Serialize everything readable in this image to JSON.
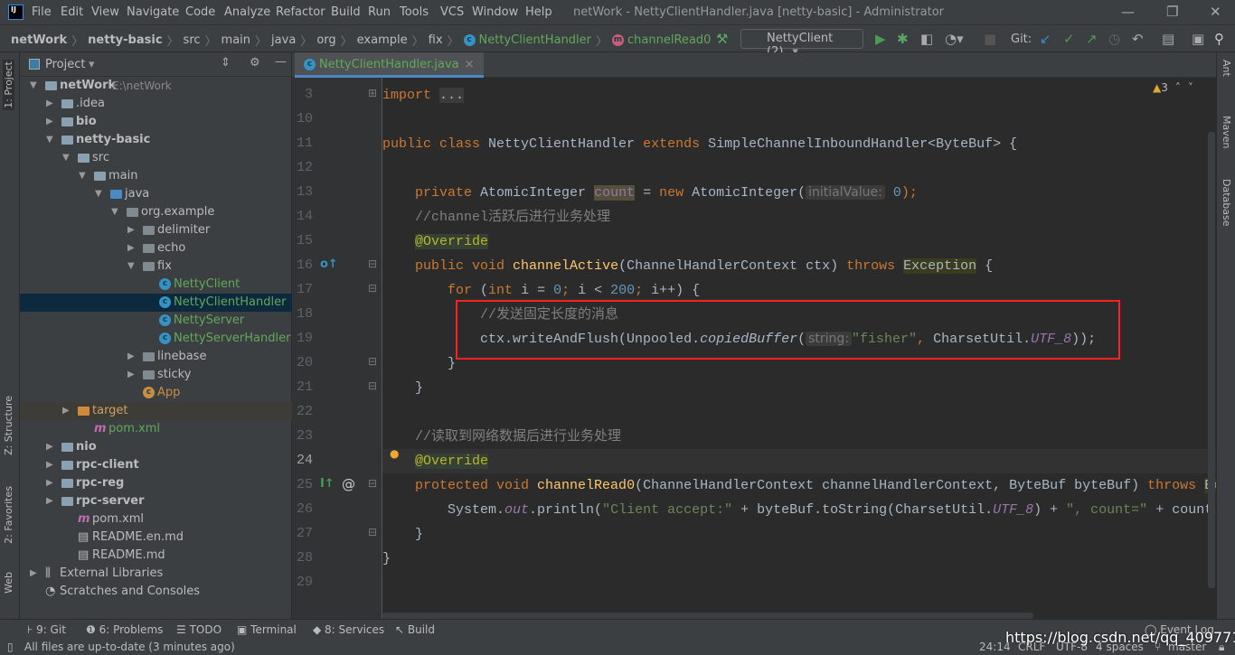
{
  "titlebar": {
    "menu": [
      "File",
      "Edit",
      "View",
      "Navigate",
      "Code",
      "Analyze",
      "Refactor",
      "Build",
      "Run",
      "Tools",
      "VCS",
      "Window",
      "Help"
    ],
    "title": "netWork - NettyClientHandler.java [netty-basic] - Administrator"
  },
  "breadcrumb": [
    {
      "label": "netWork",
      "bold": true
    },
    {
      "label": "netty-basic",
      "bold": true
    },
    {
      "label": "src"
    },
    {
      "label": "main"
    },
    {
      "label": "java"
    },
    {
      "label": "org"
    },
    {
      "label": "example"
    },
    {
      "label": "fix"
    },
    {
      "label": "NettyClientHandler",
      "icon": "class-icon"
    },
    {
      "label": "channelRead0",
      "icon": "method-icon"
    }
  ],
  "toolbar": {
    "run_config": "NettyClient (2)",
    "git_label": "Git:"
  },
  "left_tools": [
    "1: Project",
    "Z: Structure",
    "2: Favorites",
    "Web"
  ],
  "right_tools": [
    "Ant",
    "Maven",
    "Database"
  ],
  "project": {
    "header": "Project",
    "tree": [
      {
        "label": "netWork",
        "extra": "E:\\netWork",
        "level": 0,
        "arrow": "down",
        "icon": "module",
        "bold": true
      },
      {
        "label": ".idea",
        "level": 1,
        "arrow": "right",
        "icon": "folder"
      },
      {
        "label": "bio",
        "level": 1,
        "arrow": "right",
        "icon": "folder",
        "bold": true
      },
      {
        "label": "netty-basic",
        "level": 1,
        "arrow": "down",
        "icon": "folder",
        "bold": true
      },
      {
        "label": "src",
        "level": 2,
        "arrow": "down",
        "icon": "folder"
      },
      {
        "label": "main",
        "level": 3,
        "arrow": "down",
        "icon": "folder"
      },
      {
        "label": "java",
        "level": 4,
        "arrow": "down",
        "icon": "folder-blue"
      },
      {
        "label": "org.example",
        "level": 5,
        "arrow": "down",
        "icon": "package"
      },
      {
        "label": "delimiter",
        "level": 6,
        "arrow": "right",
        "icon": "package"
      },
      {
        "label": "echo",
        "level": 6,
        "arrow": "right",
        "icon": "package"
      },
      {
        "label": "fix",
        "level": 6,
        "arrow": "down",
        "icon": "package"
      },
      {
        "label": "NettyClient",
        "level": 7,
        "icon": "class",
        "green": true
      },
      {
        "label": "NettyClientHandler",
        "level": 7,
        "icon": "class",
        "green": true,
        "selected": true
      },
      {
        "label": "NettyServer",
        "level": 7,
        "icon": "class",
        "green": true
      },
      {
        "label": "NettyServerHandler",
        "level": 7,
        "icon": "class",
        "green": true
      },
      {
        "label": "linebase",
        "level": 6,
        "arrow": "right",
        "icon": "package"
      },
      {
        "label": "sticky",
        "level": 6,
        "arrow": "right",
        "icon": "package"
      },
      {
        "label": "App",
        "level": 6,
        "icon": "class",
        "orange": true
      },
      {
        "label": "target",
        "level": 2,
        "arrow": "right",
        "icon": "folder-orange",
        "excluded": true
      },
      {
        "label": "pom.xml",
        "level": 3,
        "icon": "maven",
        "green": true
      },
      {
        "label": "nio",
        "level": 1,
        "arrow": "right",
        "icon": "folder",
        "bold": true
      },
      {
        "label": "rpc-client",
        "level": 1,
        "arrow": "right",
        "icon": "folder",
        "bold": true
      },
      {
        "label": "rpc-reg",
        "level": 1,
        "arrow": "right",
        "icon": "folder",
        "bold": true
      },
      {
        "label": "rpc-server",
        "level": 1,
        "arrow": "right",
        "icon": "folder",
        "bold": true
      },
      {
        "label": "pom.xml",
        "level": 2,
        "icon": "maven"
      },
      {
        "label": "README.en.md",
        "level": 2,
        "icon": "md"
      },
      {
        "label": "README.md",
        "level": 2,
        "icon": "md"
      },
      {
        "label": "External Libraries",
        "level": 0,
        "arrow": "right",
        "icon": "libraries"
      },
      {
        "label": "Scratches and Consoles",
        "level": 1,
        "icon": "scratches",
        "nolevel": true
      }
    ]
  },
  "editor": {
    "tab": "NettyClientHandler.java",
    "warnings": "3",
    "current_line": "24",
    "lines": [
      {
        "n": "3",
        "t": [
          [
            "import",
            "kw"
          ],
          [
            " "
          ],
          [
            "...",
            "fold"
          ]
        ]
      },
      {
        "n": "10",
        "t": []
      },
      {
        "n": "11",
        "t": [
          [
            "public class ",
            "kw"
          ],
          [
            "NettyClientHandler "
          ],
          [
            "extends ",
            "kw"
          ],
          [
            "SimpleChannelInboundHandler<ByteBuf> {"
          ]
        ]
      },
      {
        "n": "12",
        "t": []
      },
      {
        "n": "13",
        "t": [
          [
            "    "
          ],
          [
            "private ",
            "kw"
          ],
          [
            "AtomicInteger "
          ],
          [
            "count",
            "fd hlo"
          ],
          [
            " = "
          ],
          [
            "new ",
            "kw"
          ],
          [
            "AtomicInteger("
          ],
          [
            "initialValue:",
            "hint"
          ],
          [
            " "
          ],
          [
            "0",
            "num"
          ],
          [
            ");",
            "kw"
          ]
        ]
      },
      {
        "n": "14",
        "t": [
          [
            "    "
          ],
          [
            "//channel活跃后进行业务处理",
            "cm"
          ]
        ]
      },
      {
        "n": "15",
        "t": [
          [
            "    "
          ],
          [
            "@Override",
            "an hl"
          ]
        ]
      },
      {
        "n": "16",
        "t": [
          [
            "    "
          ],
          [
            "public void ",
            "kw"
          ],
          [
            "channelActive",
            "md"
          ],
          [
            "(ChannelHandlerContext ctx) "
          ],
          [
            "throws ",
            "kw"
          ],
          [
            "Exception",
            "hly"
          ],
          [
            " {"
          ]
        ]
      },
      {
        "n": "17",
        "t": [
          [
            "        "
          ],
          [
            "for ",
            "kw"
          ],
          [
            "("
          ],
          [
            "int ",
            "kw"
          ],
          [
            "i = "
          ],
          [
            "0",
            "num"
          ],
          [
            "; ",
            "kw"
          ],
          [
            "i < "
          ],
          [
            "200",
            "num"
          ],
          [
            "; ",
            "kw"
          ],
          [
            "i++) {"
          ]
        ]
      },
      {
        "n": "18",
        "t": [
          [
            "            "
          ],
          [
            "//发送固定长度的消息",
            "cm"
          ]
        ]
      },
      {
        "n": "19",
        "t": [
          [
            "            "
          ],
          [
            "ctx.writeAndFlush(Unpooled."
          ],
          [
            "copiedBuffer",
            "it"
          ],
          [
            "("
          ],
          [
            "string:",
            "hint"
          ],
          [
            "\"fisher\"",
            "str"
          ],
          [
            ", ",
            "kw"
          ],
          [
            "CharsetUtil."
          ],
          [
            "UTF_8",
            "fdi"
          ],
          [
            "));"
          ]
        ]
      },
      {
        "n": "20",
        "t": [
          [
            "        }"
          ]
        ]
      },
      {
        "n": "21",
        "t": [
          [
            "    }"
          ]
        ]
      },
      {
        "n": "22",
        "t": []
      },
      {
        "n": "23",
        "t": [
          [
            "    "
          ],
          [
            "//读取到网络数据后进行业务处理",
            "cm"
          ]
        ]
      },
      {
        "n": "24",
        "t": [
          [
            "    "
          ],
          [
            "@Override",
            "an hl"
          ]
        ]
      },
      {
        "n": "25",
        "t": [
          [
            "    "
          ],
          [
            "protected void ",
            "kw"
          ],
          [
            "channelRead0",
            "md"
          ],
          [
            "(ChannelHandlerContext channelHandlerContext, ByteBuf byteBuf) "
          ],
          [
            "throws ",
            "kw"
          ],
          [
            "Ex",
            "hly"
          ]
        ]
      },
      {
        "n": "26",
        "t": [
          [
            "        System."
          ],
          [
            "out",
            "fdi"
          ],
          [
            ".println("
          ],
          [
            "\"Client accept:\"",
            "str"
          ],
          [
            " + byteBuf.toString(CharsetUtil."
          ],
          [
            "UTF_8",
            "fdi"
          ],
          [
            ") + "
          ],
          [
            "\", count=\"",
            "str"
          ],
          [
            " + count."
          ]
        ]
      },
      {
        "n": "27",
        "t": [
          [
            "    }"
          ]
        ]
      },
      {
        "n": "28",
        "t": [
          [
            "}"
          ]
        ]
      },
      {
        "n": "29",
        "t": []
      }
    ]
  },
  "bottom_tools": [
    {
      "label": "9: Git",
      "icon": "git-icon"
    },
    {
      "label": "6: Problems",
      "icon": "problems-icon"
    },
    {
      "label": "TODO",
      "icon": "todo-icon"
    },
    {
      "label": "Terminal",
      "icon": "terminal-icon"
    },
    {
      "label": "8: Services",
      "icon": "services-icon"
    },
    {
      "label": "Build",
      "icon": "build-icon"
    },
    {
      "label": "Event Log",
      "icon": "event-log-icon"
    }
  ],
  "status": {
    "message": "All files are up-to-date (3 minutes ago)",
    "position": "24:14",
    "line_sep": "CRLF",
    "encoding": "UTF-8",
    "indent": "4 spaces",
    "branch": "master"
  },
  "watermark": "https://blog.csdn.net/qq_40977118",
  "colors": {
    "keyword": "#cc7832",
    "string": "#6a8759",
    "comment": "#808080",
    "annotation": "#bbb529",
    "highlight_box": "#ff2020",
    "accent": "#4a88c7"
  }
}
